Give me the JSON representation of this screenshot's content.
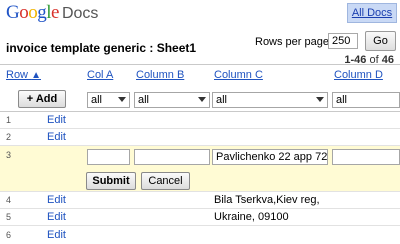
{
  "app": {
    "logo_letters": [
      "G",
      "o",
      "o",
      "g",
      "l",
      "e"
    ],
    "logo_product": "Docs",
    "all_docs_label": "All Docs"
  },
  "sheet": {
    "title": "invoice template generic : Sheet1"
  },
  "pagination": {
    "rows_per_page_label": "Rows per page:",
    "rows_per_page_value": "250",
    "go_label": "Go",
    "range_text": "1-46",
    "of_text": "of",
    "total": "46"
  },
  "columns": {
    "row_label": "Row",
    "sort_indicator": "▲",
    "col_a": "Col A",
    "col_b": "Column B",
    "col_c": "Column C",
    "col_d": "Column D"
  },
  "filters": {
    "add_label": "+ Add",
    "col_a": "all",
    "col_b": "all",
    "col_c": "all",
    "col_d": "all"
  },
  "rows": [
    {
      "num": "1",
      "edit": "Edit",
      "c": ""
    },
    {
      "num": "2",
      "edit": "Edit",
      "c": ""
    },
    {
      "num": "3",
      "edit": "",
      "c": "Pavlichenko 22 app 72"
    },
    {
      "num": "4",
      "edit": "Edit",
      "c": "Bila Tserkva,Kiev reg,"
    },
    {
      "num": "5",
      "edit": "Edit",
      "c": "Ukraine, 09100"
    },
    {
      "num": "6",
      "edit": "Edit",
      "c": ""
    }
  ],
  "edit_row": {
    "submit_label": "Submit",
    "cancel_label": "Cancel"
  }
}
